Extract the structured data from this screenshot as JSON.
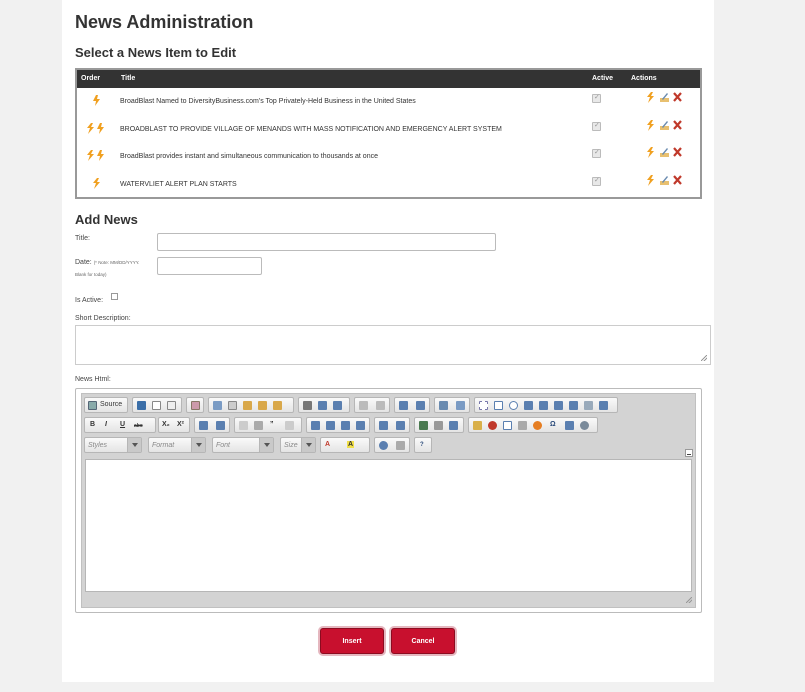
{
  "page": {
    "title": "News Administration",
    "select_heading": "Select a News Item to Edit",
    "add_heading": "Add News"
  },
  "table": {
    "headers": {
      "order": "Order",
      "title": "Title",
      "active": "Active",
      "actions": "Actions"
    },
    "rows": [
      {
        "title": "BroadBlast Named to DiversityBusiness.com's Top Privately-Held Business in the United States",
        "active": true,
        "order_icons": [
          "down-arrow-icon"
        ]
      },
      {
        "title": "BROADBLAST TO PROVIDE VILLAGE OF MENANDS WITH MASS NOTIFICATION AND EMERGENCY ALERT SYSTEM",
        "active": true,
        "order_icons": [
          "up-arrow-icon",
          "down-arrow-icon"
        ]
      },
      {
        "title": "BroadBlast provides instant and simultaneous communication to thousands at once",
        "active": true,
        "order_icons": [
          "up-arrow-icon",
          "down-arrow-icon"
        ]
      },
      {
        "title": "WATERVLIET ALERT PLAN STARTS",
        "active": true,
        "order_icons": [
          "up-arrow-icon"
        ]
      }
    ],
    "action_icons": [
      "bolt-icon",
      "edit-icon",
      "delete-icon"
    ]
  },
  "form": {
    "title_label": "Title:",
    "title_value": "",
    "date_label": "Date:",
    "date_note": "(* Note: MM/DD/YYYY.",
    "date_note2": "Blank for today)",
    "date_value": "",
    "active_label": "Is Active:",
    "active_checked": false,
    "short_desc_label": "Short Description:",
    "short_desc_value": "",
    "news_html_label": "News Html:"
  },
  "editor": {
    "source_label": "Source",
    "styles_placeholder": "Styles",
    "format_placeholder": "Format",
    "font_placeholder": "Font",
    "size_placeholder": "Size",
    "bold": "B",
    "italic": "I",
    "underline": "U",
    "strike": "abc",
    "subscript": "X₂",
    "superscript": "X²"
  },
  "buttons": {
    "insert": "Insert",
    "cancel": "Cancel"
  },
  "colors": {
    "primary": "#c8102e",
    "header_bg": "#333333",
    "bolt": "#f0a020"
  }
}
